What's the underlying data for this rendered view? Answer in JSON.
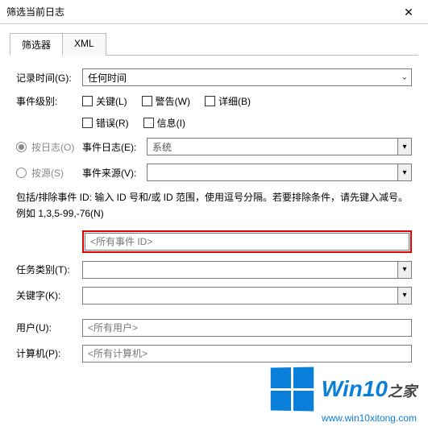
{
  "window": {
    "title": "筛选当前日志",
    "close_glyph": "✕"
  },
  "tabs": {
    "filter": "筛选器",
    "xml": "XML"
  },
  "labels": {
    "log_time": "记录时间(G):",
    "event_level": "事件级别:",
    "by_log": "按日志(O)",
    "by_source": "按源(S)",
    "event_log": "事件日志(E):",
    "event_source": "事件来源(V):",
    "task_category": "任务类别(T):",
    "keywords": "关键字(K):",
    "user": "用户(U):",
    "computer": "计算机(P):"
  },
  "values": {
    "log_time": "任何时间",
    "event_log": "系统"
  },
  "checkboxes": {
    "critical": "关键(L)",
    "warning": "警告(W)",
    "verbose": "详细(B)",
    "error": "错误(R)",
    "info": "信息(I)"
  },
  "help_text": "包括/排除事件 ID: 输入 ID 号和/或 ID 范围，使用逗号分隔。若要排除条件，请先键入减号。例如 1,3,5-99,-76(N)",
  "placeholders": {
    "event_id": "<所有事件 ID>",
    "user": "<所有用户>",
    "computer": "<所有计算机>"
  },
  "branding": {
    "main": "Win10",
    "suffix": "之家",
    "domain": "www.win10xitong.com"
  },
  "glyphs": {
    "chevron_down": "⌄",
    "triangle_down": "▾"
  }
}
